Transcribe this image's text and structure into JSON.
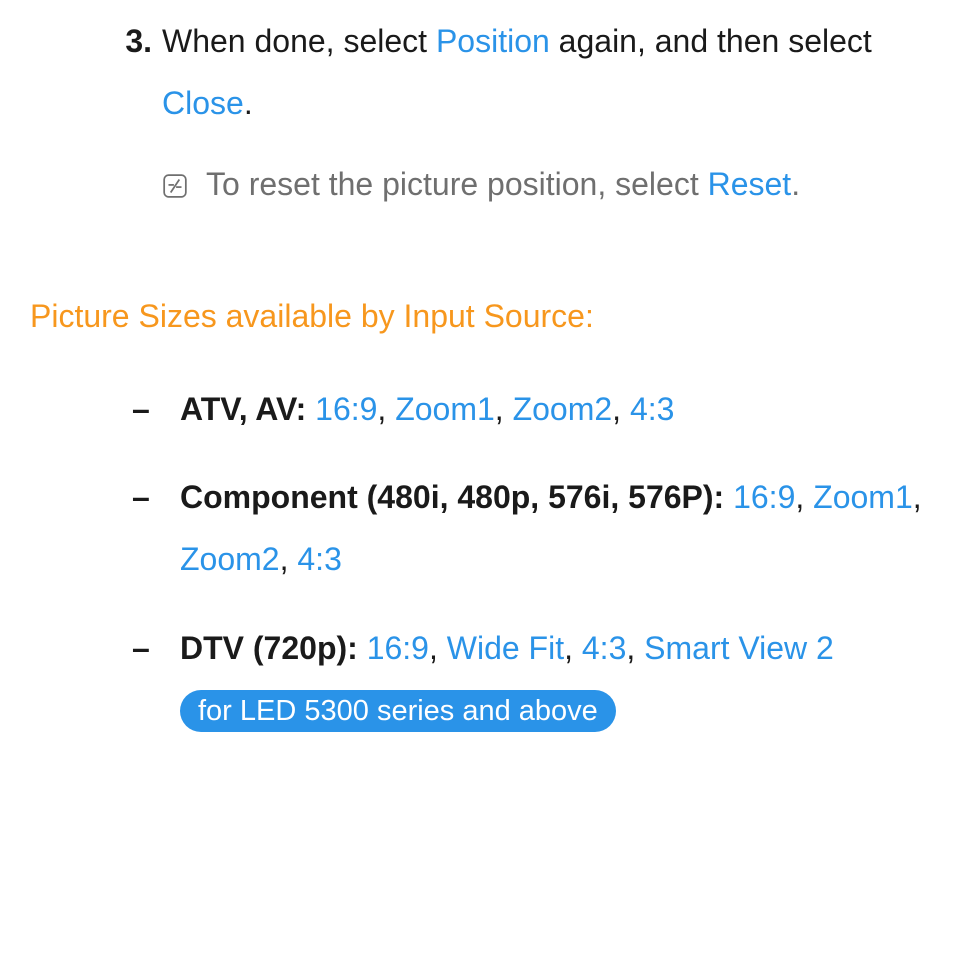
{
  "step": {
    "number": "3.",
    "text_a": "When done, select ",
    "kw1": "Position",
    "text_b": " again, and then select ",
    "kw2": "Close",
    "text_c": "."
  },
  "note": {
    "text_a": "To reset the picture position, select ",
    "kw1": "Reset",
    "text_b": "."
  },
  "section_title": "Picture Sizes available by Input Source:",
  "dash": "–",
  "sources": {
    "atv": {
      "label": "ATV, AV: ",
      "v1": "16:9",
      "sep1": ", ",
      "v2": "Zoom1",
      "sep2": ", ",
      "v3": "Zoom2",
      "sep3": ", ",
      "v4": "4:3"
    },
    "component": {
      "label": "Component (480i, 480p, 576i, 576P): ",
      "v1": "16:9",
      "sep1": ", ",
      "v2": "Zoom1",
      "sep2": ", ",
      "v3": "Zoom2",
      "sep3": ", ",
      "v4": "4:3"
    },
    "dtv": {
      "label": "DTV (720p): ",
      "v1": "16:9",
      "sep1": ", ",
      "v2": "Wide Fit",
      "sep2": ", ",
      "v3": "4:3",
      "sep3": ", ",
      "v4": "Smart View 2",
      "badge": "for LED 5300 series and above"
    }
  }
}
